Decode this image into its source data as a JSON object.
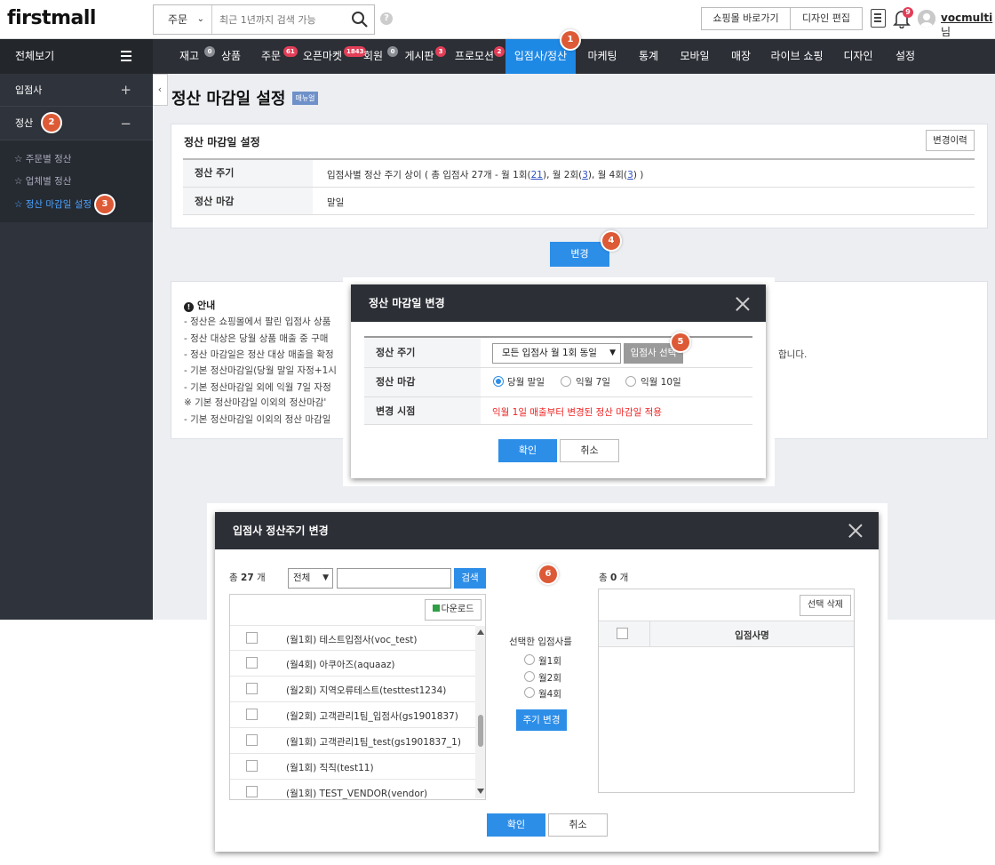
{
  "header": {
    "logo": "firstmall",
    "search_category": "주문",
    "search_placeholder": "최근 1년까지 검색 가능",
    "help": "?",
    "shop_button": "쇼핑몰 바로가기",
    "design_button": "디자인 편집",
    "notification_count": "9",
    "username": "vocmulti",
    "username_suffix": "님"
  },
  "nav": {
    "all_label": "전체보기",
    "items": [
      {
        "label": "재고",
        "badge": "0"
      },
      {
        "label": "상품"
      },
      {
        "label": "주문",
        "badge": "61"
      },
      {
        "label": "오픈마켓",
        "badge": "1843"
      },
      {
        "label": "회원",
        "badge": "0"
      },
      {
        "label": "게시판",
        "badge": "3"
      },
      {
        "label": "프로모션",
        "badge": "2"
      },
      {
        "label": "입점사/정산"
      },
      {
        "label": "마케팅"
      },
      {
        "label": "통계"
      },
      {
        "label": "모바일"
      },
      {
        "label": "매장"
      },
      {
        "label": "라이브 쇼핑"
      },
      {
        "label": "디자인"
      },
      {
        "label": "설정"
      }
    ]
  },
  "sidebar": {
    "section1": "입점사",
    "section1_sign": "+",
    "section2": "정산",
    "section2_sign": "−",
    "links": [
      "주문별 정산",
      "업체별 정산",
      "정산 마감일 설정"
    ]
  },
  "page": {
    "title": "정산 마감일 설정",
    "manual_badge": "매뉴얼",
    "card_title": "정산 마감일 설정",
    "history_button": "변경이력",
    "rows": [
      {
        "label": "정산 주기",
        "value_prefix": "입점사별 정산 주기 상이 ( 총 입점사 27개 - 월 1회(",
        "link1": "21",
        "mid1": "), 월 2회(",
        "link2": "3",
        "mid2": "), 월 4회(",
        "link3": "3",
        "suffix": ") )"
      },
      {
        "label": "정산 마감",
        "value": "말일"
      }
    ],
    "change_button": "변경"
  },
  "notice": {
    "title": "안내",
    "lines": [
      "- 정산은 쇼핑몰에서 팔린 입점사 상품",
      "- 정산 대상은 당월 상품 매출 중 구매",
      "- 정산 마감일은 정산 대상 매출을 확정",
      "- 기본 정산마감일(당월 말일 자정+1시",
      "- 기본 정산마감일 외에 익월 7일 자정",
      "   ※ 기본 정산마감일 이외의 정산마감'",
      "- 기본 정산마감일 이외의 정산 마감일"
    ],
    "tail": "합니다."
  },
  "steps": [
    "1",
    "2",
    "3",
    "4",
    "5",
    "6"
  ],
  "modal1": {
    "title": "정산 마감일 변경",
    "rows": [
      {
        "label": "정산 주기"
      },
      {
        "label": "정산 마감"
      },
      {
        "label": "변경 시점"
      }
    ],
    "cycle_select": "모든 입점사 월 1회 동일",
    "vendor_button": "입점사 선택",
    "radio_options": [
      "당월 말일",
      "익월 7일",
      "익월 10일"
    ],
    "radio_selected": "당월 말일",
    "applied_text": "익월 1일 매출부터 변경된 정산 마감일 적용",
    "ok": "확인",
    "cancel": "취소"
  },
  "modal2": {
    "title": "입점사 정산주기 변경",
    "count_prefix": "총",
    "count_value": "27",
    "count_suffix": "개",
    "filter_select": "전체",
    "search_button": "검색",
    "download_button": "다운로드",
    "vendors": [
      "(월1회) 테스트입점사(voc_test)",
      "(월4회) 아쿠아즈(aquaaz)",
      "(월2회) 지역오류테스트(testtest1234)",
      "(월2회) 고객관리1팀_입점사(gs1901837)",
      "(월1회) 고객관리1팀_test(gs1901837_1)",
      "(월1회) 직직(test11)",
      "(월1회) TEST_VENDOR(vendor)"
    ],
    "mid_title": "선택한 입점사를",
    "cycle_options": [
      "월1회",
      "월2회",
      "월4회"
    ],
    "cycle_button": "주기 변경",
    "right_count_prefix": "총",
    "right_count_value": "0",
    "right_count_suffix": "개",
    "delete_button": "선택 삭제",
    "right_header": "입점사명",
    "ok": "확인",
    "cancel": "취소"
  },
  "colors": {
    "nav_bg": "#2c2f36",
    "active_blue": "#1e88e5",
    "badge_red": "#e23e57",
    "step_orange": "#dd5a36",
    "warning_red": "#ee2222"
  }
}
